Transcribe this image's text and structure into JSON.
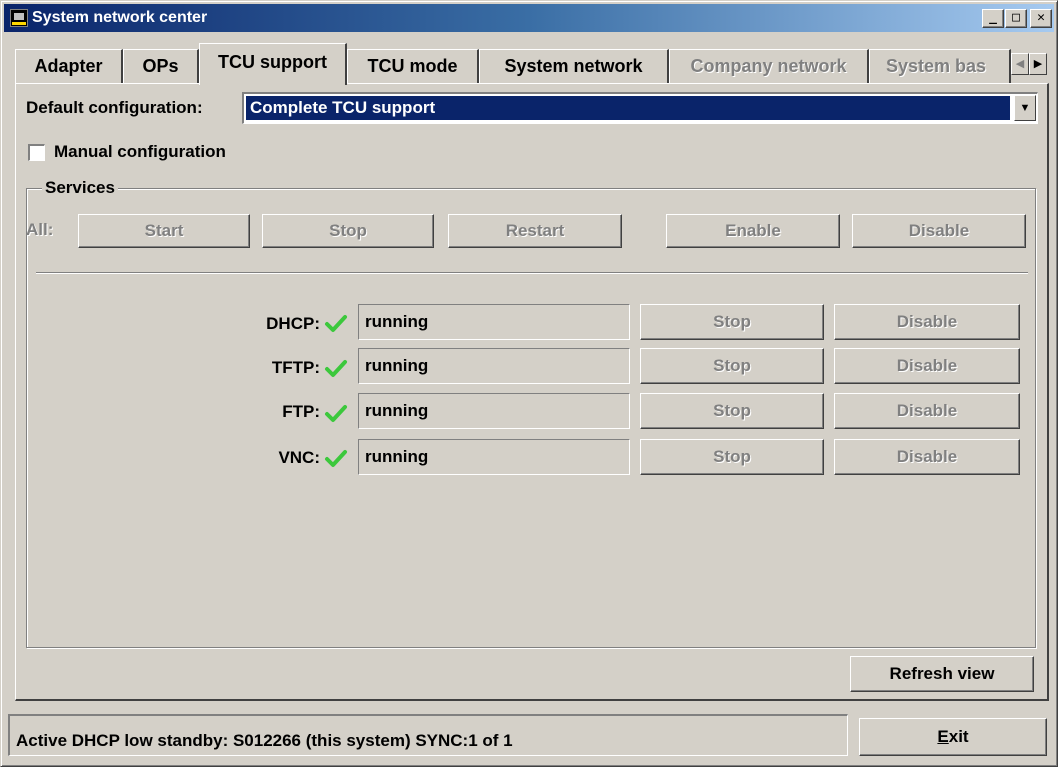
{
  "window": {
    "title": "System network center",
    "minimize_glyph": "_",
    "maximize_glyph": "□",
    "close_glyph": "✕"
  },
  "tabs": [
    {
      "label": "Adapter",
      "state": "normal"
    },
    {
      "label": "OPs",
      "state": "normal"
    },
    {
      "label": "TCU support",
      "state": "active"
    },
    {
      "label": "TCU mode",
      "state": "normal"
    },
    {
      "label": "System network",
      "state": "normal"
    },
    {
      "label": "Company network",
      "state": "disabled"
    },
    {
      "label": "System bas",
      "state": "disabled"
    }
  ],
  "tab_scroll": {
    "left": "◀",
    "right": "▶"
  },
  "config": {
    "label": "Default configuration:",
    "value": "Complete TCU support",
    "dropdown_glyph": "▼"
  },
  "manual": {
    "label": "Manual configuration",
    "checked": false
  },
  "services": {
    "group_label": "Services",
    "all_label": "All:",
    "all_buttons": {
      "start": "Start",
      "stop": "Stop",
      "restart": "Restart",
      "enable": "Enable",
      "disable": "Disable"
    },
    "rows": [
      {
        "name": "DHCP:",
        "status": "running",
        "stop": "Stop",
        "disable": "Disable",
        "icon": "check-icon"
      },
      {
        "name": "TFTP:",
        "status": "running",
        "stop": "Stop",
        "disable": "Disable",
        "icon": "check-icon"
      },
      {
        "name": "FTP:",
        "status": "running",
        "stop": "Stop",
        "disable": "Disable",
        "icon": "check-icon"
      },
      {
        "name": "VNC:",
        "status": "running",
        "stop": "Stop",
        "disable": "Disable",
        "icon": "check-icon"
      }
    ]
  },
  "refresh_label": "Refresh view",
  "status_text": "Active DHCP low standby: S012266 (this system) SYNC:1 of 1",
  "exit_label": "Exit",
  "colors": {
    "face": "#d4d0c8",
    "selection": "#0a246a",
    "check": "#3cc83c",
    "disabled_text": "#808080"
  }
}
